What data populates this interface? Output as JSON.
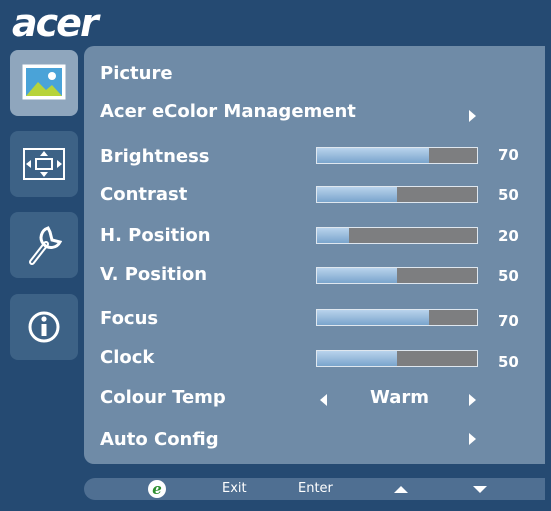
{
  "brand": {
    "logo_text": "acer"
  },
  "sidebar": {
    "items": [
      {
        "name": "picture",
        "icon": "picture-icon",
        "active": true
      },
      {
        "name": "position",
        "icon": "position-icon",
        "active": false
      },
      {
        "name": "setup",
        "icon": "wrench-icon",
        "active": false
      },
      {
        "name": "information",
        "icon": "info-icon",
        "active": false
      }
    ]
  },
  "menu": {
    "title": "Picture",
    "ecolor": {
      "label": "Acer eColor Management"
    },
    "sliders": [
      {
        "label": "Brightness",
        "value": 70,
        "value_text": "70"
      },
      {
        "label": "Contrast",
        "value": 50,
        "value_text": "50"
      },
      {
        "label": "H. Position",
        "value": 20,
        "value_text": "20"
      },
      {
        "label": "V. Position",
        "value": 50,
        "value_text": "50"
      },
      {
        "label": "Focus",
        "value": 70,
        "value_text": "70"
      },
      {
        "label": "Clock",
        "value": 50,
        "value_text": "50"
      }
    ],
    "colour_temp": {
      "label": "Colour Temp",
      "value": "Warm"
    },
    "auto_config": {
      "label": "Auto Config"
    }
  },
  "footer": {
    "exit_label": "Exit",
    "enter_label": "Enter",
    "e_icon": "e-key-icon",
    "up_icon": "up-arrow-icon",
    "down_icon": "down-arrow-icon"
  },
  "colors": {
    "background": "#254a72",
    "panel": "#6f8ba7",
    "sidebar_active": "#8fa6bd",
    "sidebar_idle": "#3d6286",
    "slider_fill": "#9bbfe0",
    "slider_track": "#7d7e80",
    "footer": "#4f6f92",
    "text": "#ffffff",
    "e_icon_green": "#2f8f2f"
  }
}
